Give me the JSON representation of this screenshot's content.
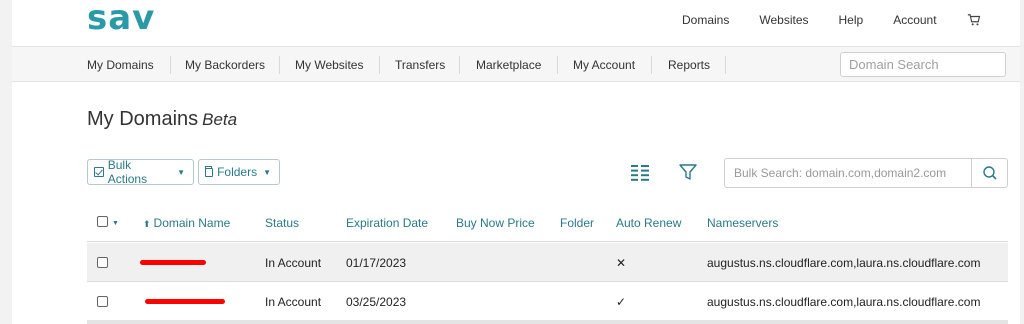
{
  "brand": {
    "logo_text": "sav",
    "accent": "#2a9aa8"
  },
  "topnav": [
    "Domains",
    "Websites",
    "Help",
    "Account"
  ],
  "subnav": [
    "My Domains",
    "My Backorders",
    "My Websites",
    "Transfers",
    "Marketplace",
    "My Account",
    "Reports"
  ],
  "domain_search": {
    "placeholder": "Domain Search",
    "value": ""
  },
  "page": {
    "title": "My Domains",
    "badge": "Beta"
  },
  "toolbar": {
    "bulk_actions": "Bulk Actions",
    "folders": "Folders"
  },
  "bulk_search": {
    "placeholder": "Bulk Search: domain.com,domain2.com",
    "value": ""
  },
  "table": {
    "columns": [
      "Domain Name",
      "Status",
      "Expiration Date",
      "Buy Now Price",
      "Folder",
      "Auto Renew",
      "Nameservers"
    ],
    "rows": [
      {
        "status": "In Account",
        "expiration": "01/17/2023",
        "buy_now": "",
        "folder": "",
        "auto_renew": "✕",
        "nameservers": "augustus.ns.cloudflare.com,laura.ns.cloudflare.com"
      },
      {
        "status": "In Account",
        "expiration": "03/25/2023",
        "buy_now": "",
        "folder": "",
        "auto_renew": "✓",
        "nameservers": "augustus.ns.cloudflare.com,laura.ns.cloudflare.com"
      }
    ]
  }
}
